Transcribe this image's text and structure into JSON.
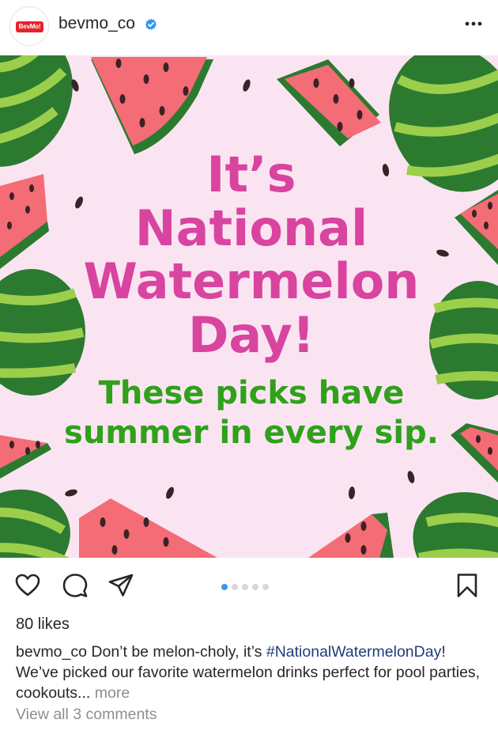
{
  "header": {
    "avatar_text": "BevMo!",
    "username": "bevmo_co",
    "verified_icon": "verified-badge-icon",
    "more_icon": "more-options-icon"
  },
  "post": {
    "headline": [
      "It’s",
      "National",
      "Watermelon",
      "Day!"
    ],
    "subhead": [
      "These picks have",
      "summer in every sip."
    ],
    "colors": {
      "background": "#fbe4f2",
      "headline": "#d8449f",
      "subhead": "#2fa11b",
      "rind_dark": "#2c7a30",
      "rind_light": "#9bcf4b",
      "flesh": "#f36c76",
      "seed": "#3b2226"
    }
  },
  "actions": {
    "like_icon": "heart-icon",
    "comment_icon": "comment-icon",
    "share_icon": "send-icon",
    "save_icon": "bookmark-icon",
    "carousel_count": 5,
    "carousel_active": 1
  },
  "likes": "80 likes",
  "caption": {
    "username": "bevmo_co",
    "text_1": " Don’t be melon-choly, it’s ",
    "hashtag": "#NationalWatermelonDay",
    "text_2": "! We’ve picked our favorite watermelon drinks perfect for pool parties, cookouts...",
    "more": " more"
  },
  "comments_link": "View all 3 comments"
}
